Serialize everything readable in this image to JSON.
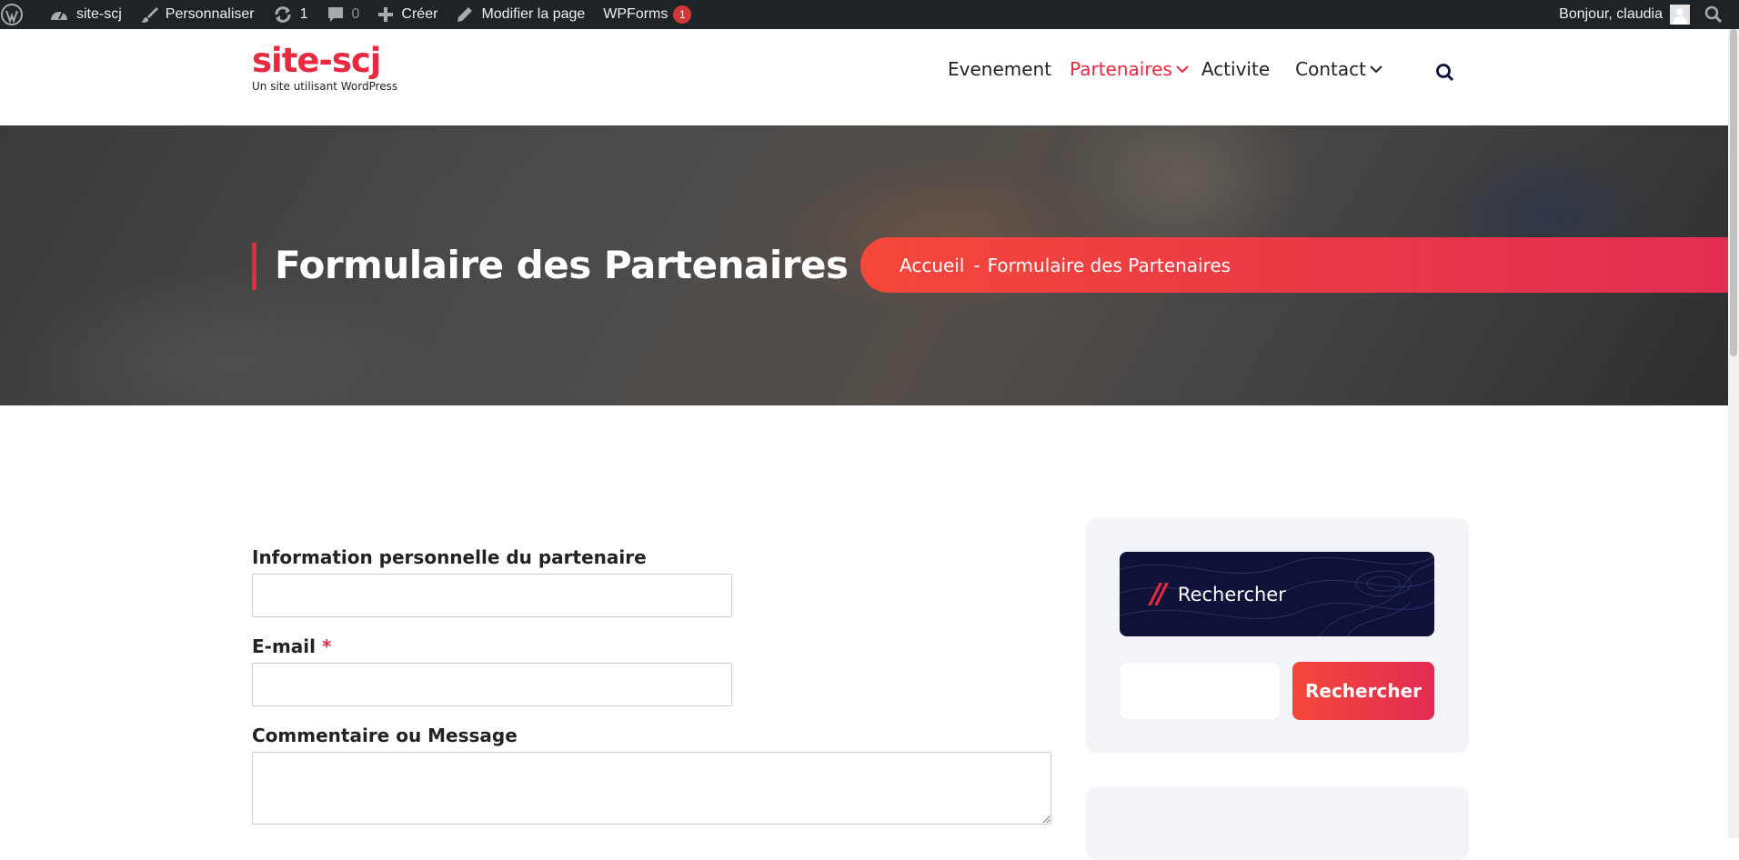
{
  "adminbar": {
    "wp_logo": "wordpress-icon",
    "site": "site-scj",
    "customize": "Personnaliser",
    "updates_count": "1",
    "comments_count": "0",
    "new": "Créer",
    "edit": "Modifier la page",
    "wpforms": "WPForms",
    "wpforms_count": "1",
    "greeting": "Bonjour, claudia"
  },
  "site": {
    "title": "site-scj",
    "tagline": "Un site utilisant WordPress"
  },
  "nav": {
    "items": [
      {
        "label": "Evenement"
      },
      {
        "label": "Partenaires"
      },
      {
        "label": "Activite"
      },
      {
        "label": "Contact"
      }
    ]
  },
  "hero": {
    "title": "Formulaire des Partenaires",
    "breadcrumb_home": "Accueil",
    "breadcrumb_sep": "-",
    "breadcrumb_current": "Formulaire des Partenaires"
  },
  "form": {
    "field1_label": "Information personnelle du partenaire",
    "field1_value": "",
    "email_label": "E-mail",
    "email_required": "*",
    "email_value": "",
    "message_label": "Commentaire ou Message",
    "message_value": ""
  },
  "sidebar": {
    "widget_title": "Rechercher",
    "widget_slash": "//",
    "search_value": "",
    "search_button": "Rechercher"
  },
  "colors": {
    "accent": "#e8293f",
    "admin_bar": "#1d2327",
    "widget_title_bg": "#0f1238",
    "sidebar_bg": "#f3f4f8"
  }
}
